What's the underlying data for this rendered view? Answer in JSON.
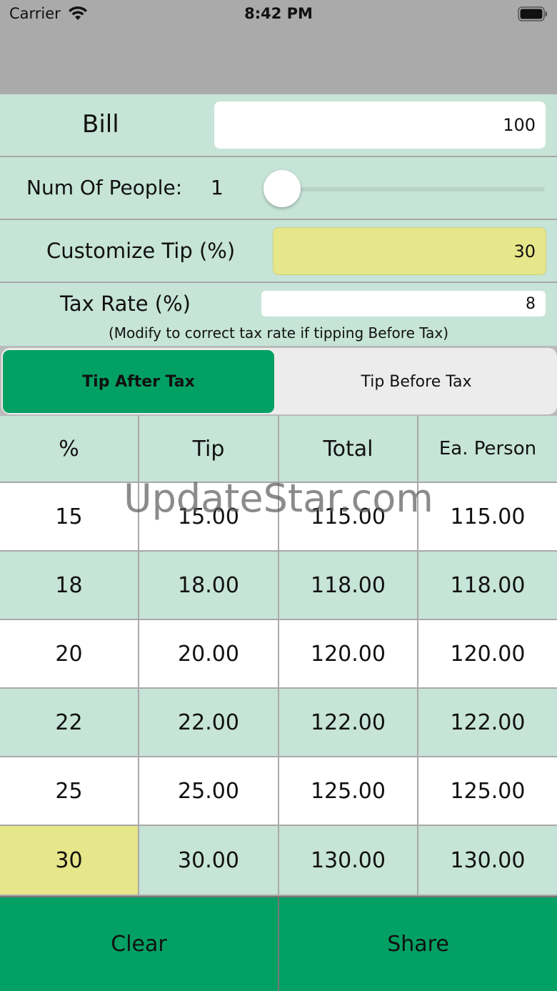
{
  "status_bar": {
    "carrier": "Carrier",
    "time": "8:42 PM"
  },
  "bill": {
    "label": "Bill",
    "value": "100"
  },
  "people": {
    "label": "Num Of People:",
    "count": "1",
    "slider_fraction": 0.0
  },
  "custom_tip": {
    "label": "Customize Tip (%)",
    "value": "30"
  },
  "tax": {
    "label": "Tax Rate (%)",
    "value": "8",
    "note": "(Modify to correct tax rate if tipping Before Tax)"
  },
  "segment": {
    "options": [
      "Tip After Tax",
      "Tip Before Tax"
    ],
    "selected": "Tip After Tax"
  },
  "table": {
    "headers": [
      "%",
      "Tip",
      "Total",
      "Ea. Person"
    ],
    "rows": [
      [
        "15",
        "15.00",
        "115.00",
        "115.00"
      ],
      [
        "18",
        "18.00",
        "118.00",
        "118.00"
      ],
      [
        "20",
        "20.00",
        "120.00",
        "120.00"
      ],
      [
        "22",
        "22.00",
        "122.00",
        "122.00"
      ],
      [
        "25",
        "25.00",
        "125.00",
        "125.00"
      ],
      [
        "30",
        "30.00",
        "130.00",
        "130.00"
      ]
    ],
    "highlighted_percent": "30"
  },
  "watermark": "UpdateStar.com",
  "buttons": {
    "clear": "Clear",
    "share": "Share"
  },
  "colors": {
    "accent_green": "#03a064",
    "row_green": "#c6e4d7",
    "highlight_yellow": "#e6e68a",
    "nav_gray": "#aaaaaa"
  }
}
